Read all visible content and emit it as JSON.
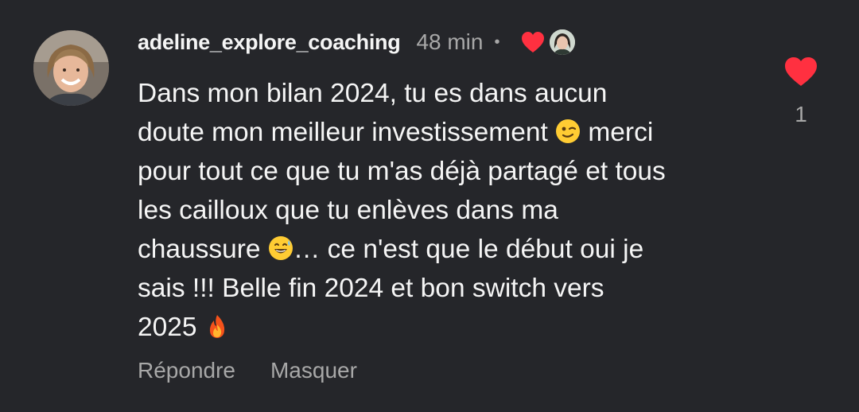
{
  "comment": {
    "username": "adeline_explore_coaching",
    "timestamp": "48 min",
    "separator": "•",
    "lines": {
      "l1": "Dans mon bilan 2024, tu es dans aucun",
      "l2a": "doute mon meilleur investissement ",
      "l2b": " merci",
      "l3": "pour tout ce que tu m'as déjà partagé et tous",
      "l4": "les cailloux que tu enlèves dans ma",
      "l5a": "chaussure ",
      "l5b": "… ce n'est que le début oui je",
      "l6": "sais !!! Belle fin 2024 et bon switch vers",
      "l7": "2025 "
    },
    "emojis": [
      "winking-face",
      "grinning-face-with-sweat",
      "fire"
    ]
  },
  "actions": {
    "reply_label": "Répondre",
    "hide_label": "Masquer"
  },
  "likes": {
    "count": "1",
    "liked": true,
    "heart_color": "#ff3040"
  },
  "creator_liked": true
}
